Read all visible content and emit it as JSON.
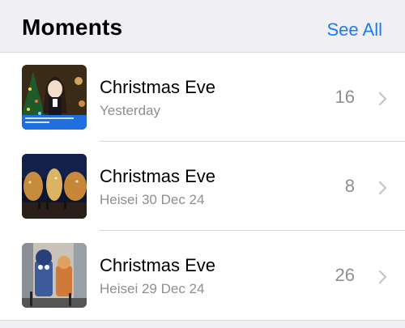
{
  "header": {
    "title": "Moments",
    "see_all_label": "See All"
  },
  "colors": {
    "accent": "#1a7cf5",
    "secondary_text": "#8e8e93",
    "background": "#efeff4"
  },
  "moments": [
    {
      "title": "Christmas Eve",
      "subtitle": "Yesterday",
      "count": "16",
      "thumbnail": "anime-character-christmas-tree-screenshot"
    },
    {
      "title": "Christmas Eve",
      "subtitle": "Heisei 30 Dec 24",
      "count": "8",
      "thumbnail": "illuminated-trees-night-street"
    },
    {
      "title": "Christmas Eve",
      "subtitle": "Heisei 29 Dec 24",
      "count": "26",
      "thumbnail": "cartoon-character-building-display"
    }
  ],
  "icons": {
    "row_chevron": "chevron-right-icon"
  }
}
